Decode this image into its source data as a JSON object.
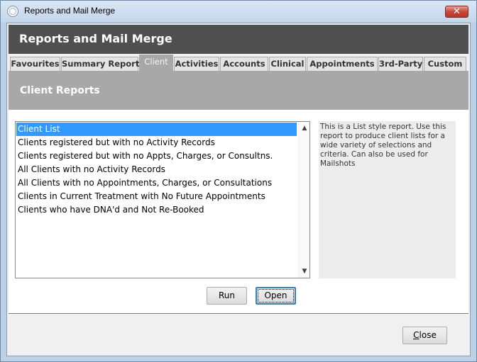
{
  "window": {
    "title": "Reports and Mail Merge",
    "close_glyph": "✕"
  },
  "header": {
    "title": "Reports and Mail Merge"
  },
  "tabs": [
    {
      "label": "Favourites"
    },
    {
      "label": "Summary Reports"
    },
    {
      "label": "Client"
    },
    {
      "label": "Activities"
    },
    {
      "label": "Accounts"
    },
    {
      "label": "Clinical"
    },
    {
      "label": "Appointments"
    },
    {
      "label": "3rd-Party"
    },
    {
      "label": "Custom"
    }
  ],
  "active_tab": "Client",
  "section": {
    "title": "Client Reports"
  },
  "reports": [
    {
      "label": "Client List"
    },
    {
      "label": "Clients registered but with no Activity Records"
    },
    {
      "label": "Clients registered but with no Appts, Charges, or Consultns."
    },
    {
      "label": "All Clients with no Activity Records"
    },
    {
      "label": "All Clients with no Appointments, Charges, or Consultations"
    },
    {
      "label": "Clients in Current Treatment with No Future Appointments"
    },
    {
      "label": "Clients who have DNA'd and Not Re-Booked"
    }
  ],
  "selected_report": "Client List",
  "description": "This is a List style report. Use this report to produce client lists for a wide variety of selections and criteria. Can also be used for Mailshots",
  "buttons": {
    "run": "Run",
    "open": "Open",
    "close_first": "C",
    "close_rest": "lose"
  },
  "colors": {
    "header_bg": "#4f4f4f",
    "section_bg": "#a8a8a8",
    "selection": "#3399ff"
  }
}
